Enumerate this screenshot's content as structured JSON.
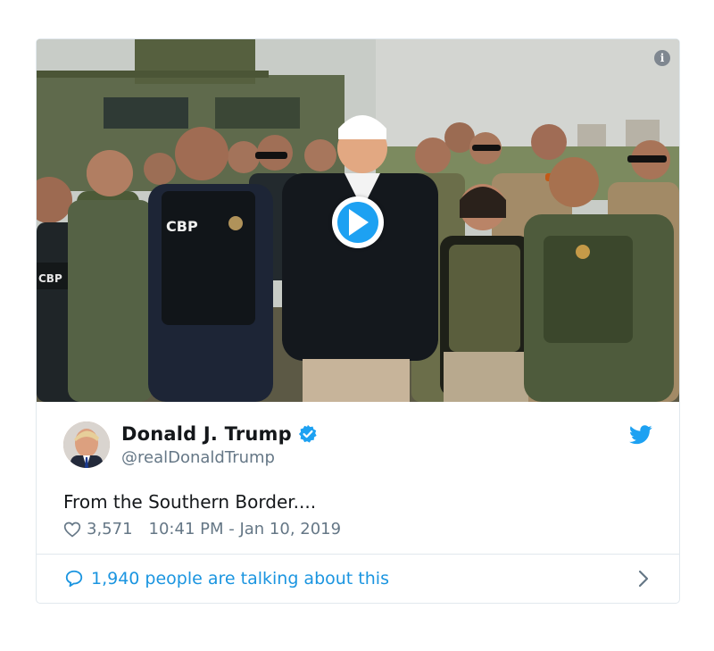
{
  "tweet": {
    "display_name": "Donald J. Trump",
    "handle": "@realDonaldTrump",
    "text": "From the Southern Border....",
    "likes": "3,571",
    "timestamp": "10:41 PM - Jan 10, 2019",
    "talking": "1,940 people are talking about this",
    "verified": true
  },
  "media": {
    "type": "video",
    "info_icon": "i",
    "vest_label": "CBP"
  },
  "icons": {
    "info": "info-icon",
    "play": "play-icon",
    "verified": "verified-badge-icon",
    "twitter": "twitter-bird-icon",
    "heart": "heart-icon",
    "bubble": "speech-bubble-icon",
    "chevron": "chevron-right-icon"
  },
  "colors": {
    "twitter_blue": "#1da1f2",
    "link_blue": "#1b95e0",
    "name": "#14171a",
    "muted": "#657786",
    "border": "#e1e8ed"
  }
}
